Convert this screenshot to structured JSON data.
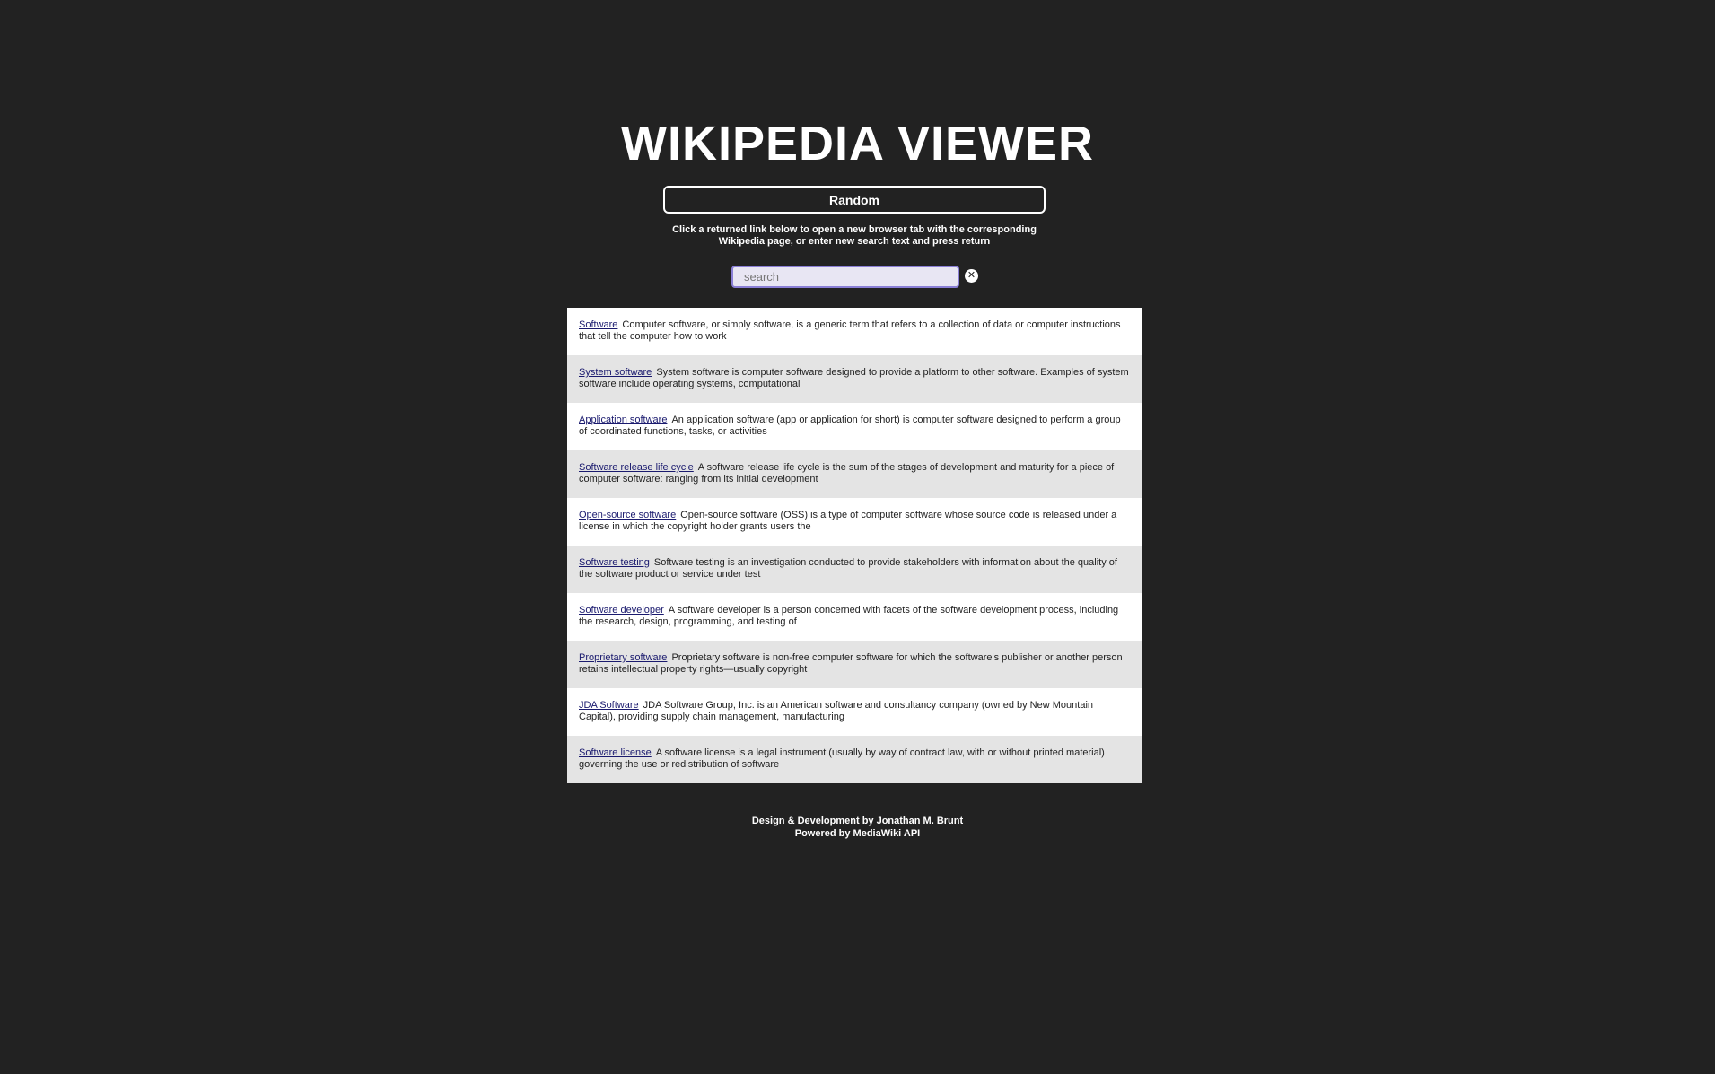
{
  "header": {
    "title": "WIKIPEDIA VIEWER",
    "random_label": "Random",
    "instructions": "Click a returned link below to open a new browser tab with the corresponding Wikipedia page, or enter new search text and press return"
  },
  "search": {
    "placeholder": "search",
    "value": "",
    "clear_icon": "close-circle-icon"
  },
  "results": [
    {
      "title": "Software",
      "snippet": "Computer software, or simply software, is a generic term that refers to a collection of data or computer instructions that tell the computer how to work"
    },
    {
      "title": "System software",
      "snippet": "System software is computer software designed to provide a platform to other software. Examples of system software include operating systems, computational"
    },
    {
      "title": "Application software",
      "snippet": "An application software (app or application for short) is computer software designed to perform a group of coordinated functions, tasks, or activities"
    },
    {
      "title": "Software release life cycle",
      "snippet": "A software release life cycle is the sum of the stages of development and maturity for a piece of computer software: ranging from its initial development"
    },
    {
      "title": "Open-source software",
      "snippet": "Open-source software (OSS) is a type of computer software whose source code is released under a license in which the copyright holder grants users the"
    },
    {
      "title": "Software testing",
      "snippet": "Software testing is an investigation conducted to provide stakeholders with information about the quality of the software product or service under test"
    },
    {
      "title": "Software developer",
      "snippet": "A software developer is a person concerned with facets of the software development process, including the research, design, programming, and testing of"
    },
    {
      "title": "Proprietary software",
      "snippet": "Proprietary software is non-free computer software for which the software's publisher or another person retains intellectual property rights—usually copyright"
    },
    {
      "title": "JDA Software",
      "snippet": "JDA Software Group, Inc. is an American software and consultancy company (owned by New Mountain Capital), providing supply chain management, manufacturing"
    },
    {
      "title": "Software license",
      "snippet": "A software license is a legal instrument (usually by way of contract law, with or without printed material) governing the use or redistribution of software"
    }
  ],
  "footer": {
    "credit": "Design & Development by Jonathan M. Brunt",
    "powered": "Powered by MediaWiki API"
  },
  "colors": {
    "background": "#222222",
    "result_alt": "#e4e4e4",
    "link": "#1a1a6e",
    "search_border": "#8a7fd6"
  }
}
